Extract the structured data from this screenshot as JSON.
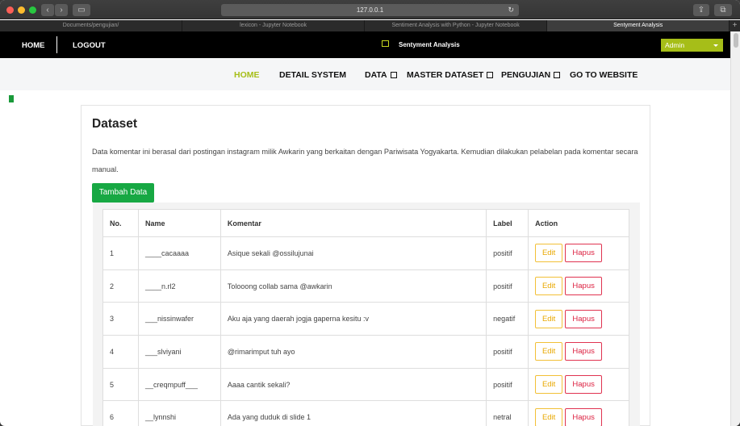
{
  "browser": {
    "address": "127.0.0.1",
    "tabs": [
      "Documents/pengujian/",
      "lexicon - Jupyter Notebook",
      "Sentiment Analysis with Python - Jupyter Notebook",
      "Sentyment Analysis"
    ]
  },
  "topnav": {
    "home": "HOME",
    "logout": "LOGOUT",
    "brand": "Sentyment Analysis",
    "user": "Admin"
  },
  "mainnav": {
    "home": "HOME",
    "detail": "DETAIL SYSTEM",
    "data": "DATA",
    "master": "MASTER DATASET",
    "pengujian": "PENGUJIAN",
    "website": "GO TO WEBSITE"
  },
  "card": {
    "title": "Dataset",
    "description": "Data komentar ini berasal dari postingan instagram milik Awkarin yang berkaitan dengan Pariwisata Yogyakarta. Kemudian dilakukan pelabelan pada komentar secara manual.",
    "add_button": "Tambah Data"
  },
  "table": {
    "headers": {
      "no": "No.",
      "name": "Name",
      "komentar": "Komentar",
      "label": "Label",
      "action": "Action"
    },
    "edit_label": "Edit",
    "delete_label": "Hapus",
    "rows": [
      {
        "no": "1",
        "name": "____cacaaaa",
        "komentar": "Asique sekali @ossilujunai",
        "label": "positif"
      },
      {
        "no": "2",
        "name": "____n.rl2",
        "komentar": "Tolooong collab sama @awkarin",
        "label": "positif"
      },
      {
        "no": "3",
        "name": "___nissinwafer",
        "komentar": "Aku aja yang daerah jogja gaperna kesitu :v",
        "label": "negatif"
      },
      {
        "no": "4",
        "name": "___slviyani",
        "komentar": "@rimarimput tuh ayo",
        "label": "positif"
      },
      {
        "no": "5",
        "name": "__creqmpuff___",
        "komentar": "Aaaa cantik sekali?",
        "label": "positif"
      },
      {
        "no": "6",
        "name": "__lynnshi",
        "komentar": "Ada yang duduk di slide 1",
        "label": "netral"
      }
    ]
  },
  "colors": {
    "accent": "#a6be18",
    "add": "#17a843",
    "edit": "#f2c037",
    "delete": "#dc1f3f"
  }
}
